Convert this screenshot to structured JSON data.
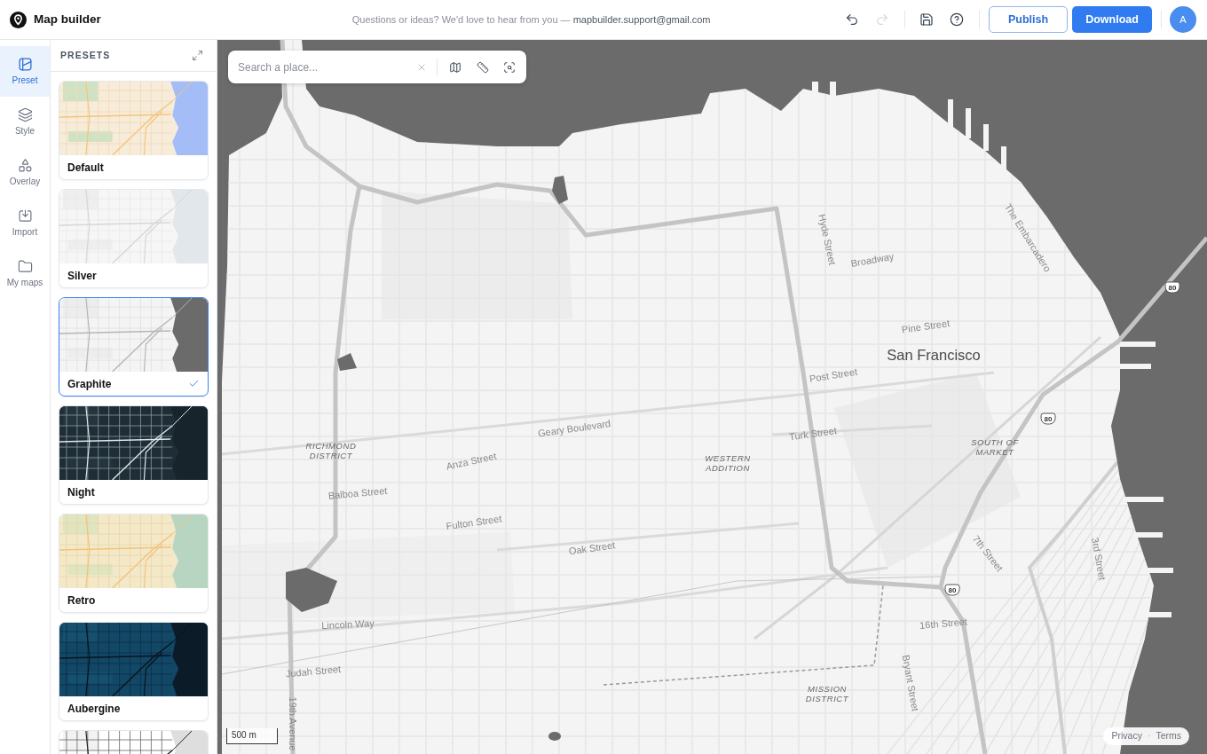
{
  "header": {
    "app_name": "Map builder",
    "message": "Questions or ideas? We'd love to hear from you —",
    "email": "mapbuilder.support@gmail.com",
    "tools": [
      {
        "kind": "undo",
        "disabled": false
      },
      {
        "kind": "redo",
        "disabled": true
      },
      {
        "kind": "save",
        "disabled": false
      },
      {
        "kind": "help",
        "disabled": false
      }
    ],
    "publish": "Publish",
    "download": "Download",
    "avatar": "A"
  },
  "nav": [
    {
      "kind": "preset",
      "label": "Preset",
      "selected": true
    },
    {
      "kind": "style",
      "label": "Style",
      "selected": false
    },
    {
      "kind": "overlay",
      "label": "Overlay",
      "selected": false
    },
    {
      "kind": "import",
      "label": "Import",
      "selected": false
    },
    {
      "kind": "folder",
      "label": "My maps",
      "selected": false
    }
  ],
  "presets_panel": {
    "title": "PRESETS",
    "presets": [
      {
        "kind": "default",
        "name": "Default",
        "selected": false
      },
      {
        "kind": "silver",
        "name": "Silver",
        "selected": false
      },
      {
        "kind": "graphite",
        "name": "Graphite",
        "selected": true
      },
      {
        "kind": "night",
        "name": "Night",
        "selected": false
      },
      {
        "kind": "retro",
        "name": "Retro",
        "selected": false
      },
      {
        "kind": "aubergine",
        "name": "Aubergine",
        "selected": false
      },
      {
        "kind": "lines",
        "selected": false
      }
    ]
  },
  "map": {
    "search": {
      "placeholder": "Search a place..."
    },
    "labels": [
      {
        "kind": "street",
        "text": "Hyde Street"
      },
      {
        "kind": "street",
        "text": "The Embarcadero"
      },
      {
        "kind": "street",
        "text": "Broadway"
      },
      {
        "kind": "shield",
        "text": "80"
      },
      {
        "kind": "street",
        "text": "Pine Street"
      },
      {
        "kind": "city",
        "text": "San Francisco"
      },
      {
        "kind": "street",
        "text": "Post Street"
      },
      {
        "kind": "shield",
        "text": "80"
      },
      {
        "kind": "street",
        "text": "Geary Boulevard"
      },
      {
        "kind": "street",
        "text": "Turk Street"
      },
      {
        "kind": "district",
        "text": "RICHMOND DISTRICT"
      },
      {
        "kind": "district",
        "text": "SOUTH OF MARKET"
      },
      {
        "kind": "district",
        "text": "WESTERN ADDITION"
      },
      {
        "kind": "street",
        "text": "Anza Street"
      },
      {
        "kind": "street",
        "text": "Balboa Street"
      },
      {
        "kind": "street",
        "text": "Fulton Street"
      },
      {
        "kind": "street",
        "text": "Oak Street"
      },
      {
        "kind": "street",
        "text": "3rd Street"
      },
      {
        "kind": "street",
        "text": "7th Street"
      },
      {
        "kind": "shield",
        "text": "80"
      },
      {
        "kind": "street",
        "text": "16th Street"
      },
      {
        "kind": "street",
        "text": "Lincoln Way"
      },
      {
        "kind": "street",
        "text": "Judah Street"
      },
      {
        "kind": "street",
        "text": "Bryant Street"
      },
      {
        "kind": "district",
        "text": "MISSION DISTRICT"
      },
      {
        "kind": "street",
        "text": "19th Avenue"
      }
    ],
    "scale": "500 m",
    "footer_links": [
      "Privacy",
      "Terms"
    ],
    "footer_separator": "·"
  }
}
